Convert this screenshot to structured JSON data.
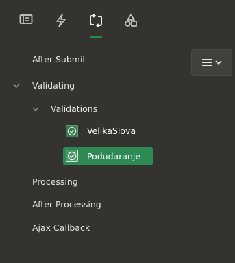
{
  "toolbar": {
    "tabs": [
      {
        "icon": "panel-icon",
        "active": false
      },
      {
        "icon": "lightning-icon",
        "active": false
      },
      {
        "icon": "processing-loop-icon",
        "active": true
      },
      {
        "icon": "shapes-icon",
        "active": false
      }
    ],
    "indicator_color": "#2f8a4e"
  },
  "options_button": {
    "icon": "menu-lines-icon",
    "chevron": "chevron-down-icon"
  },
  "tree": {
    "after_submit": "After Submit",
    "validating": "Validating",
    "validations": "Validations",
    "items": [
      {
        "label": "VelikaSlova",
        "selected": false
      },
      {
        "label": "Podudaranje",
        "selected": true
      }
    ],
    "processing": "Processing",
    "after_processing": "After Processing",
    "ajax_callback": "Ajax Callback"
  },
  "colors": {
    "background": "#353330",
    "selected_bg": "#2e8a55",
    "check_bg": "#3d7a52",
    "text": "#e7e4df"
  }
}
